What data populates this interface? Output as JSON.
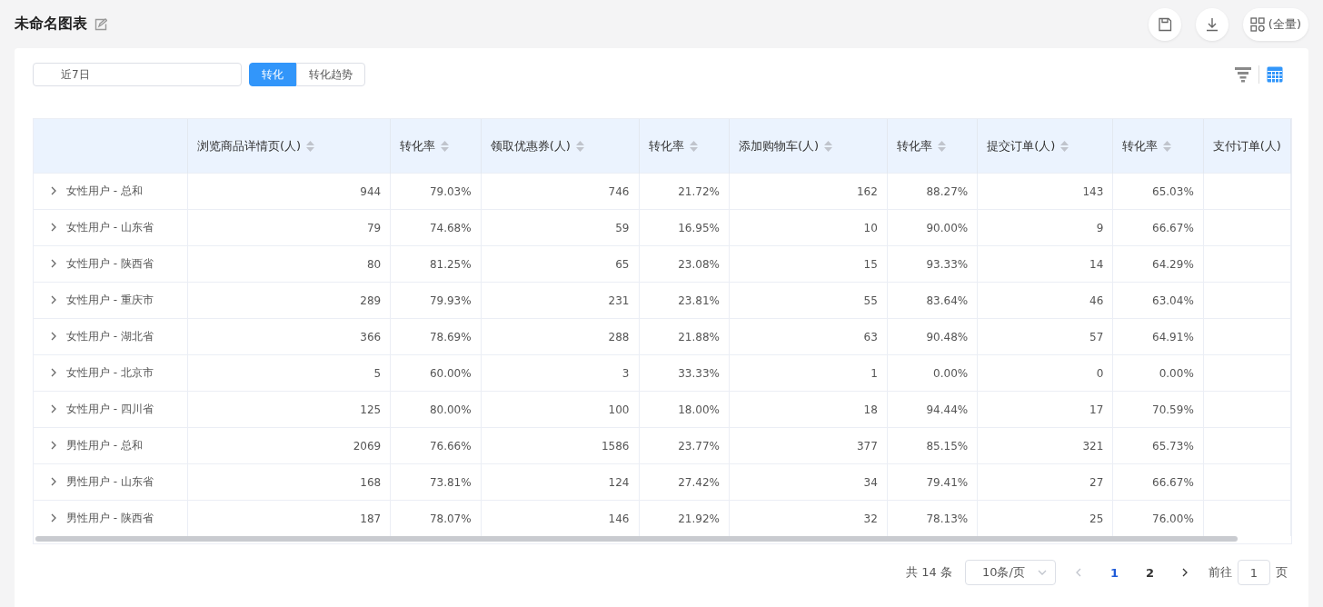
{
  "header": {
    "title": "未命名图表",
    "actions": [
      {
        "kind": "save"
      },
      {
        "kind": "download"
      },
      {
        "kind": "layout",
        "label": "(全量)"
      }
    ]
  },
  "toolbar": {
    "date_range": {
      "value": "近7日"
    },
    "tabs": [
      {
        "label": "转化",
        "selected": true
      },
      {
        "label": "转化趋势",
        "selected": false
      }
    ],
    "view_toggles": [
      {
        "kind": "funnel",
        "selected": false
      },
      {
        "kind": "table",
        "selected": true
      }
    ]
  },
  "table": {
    "columns": [
      {
        "sortable": false
      },
      {
        "label": "浏览商品详情页(人)",
        "sortable": true
      },
      {
        "label": "转化率",
        "sortable": true
      },
      {
        "label": "领取优惠券(人)",
        "sortable": true
      },
      {
        "label": "转化率",
        "sortable": true
      },
      {
        "label": "添加购物车(人)",
        "sortable": true
      },
      {
        "label": "转化率",
        "sortable": true
      },
      {
        "label": "提交订单(人)",
        "sortable": true
      },
      {
        "label": "转化率",
        "sortable": true
      },
      {
        "label": "支付订单(人)",
        "sortable": false
      }
    ],
    "rows": [
      {
        "expanded": false,
        "cells": [
          "女性用户 - 总和",
          "944",
          "79.03%",
          "746",
          "21.72%",
          "162",
          "88.27%",
          "143",
          "65.03%"
        ]
      },
      {
        "expanded": false,
        "cells": [
          "女性用户 - 山东省",
          "79",
          "74.68%",
          "59",
          "16.95%",
          "10",
          "90.00%",
          "9",
          "66.67%"
        ]
      },
      {
        "expanded": false,
        "cells": [
          "女性用户 - 陕西省",
          "80",
          "81.25%",
          "65",
          "23.08%",
          "15",
          "93.33%",
          "14",
          "64.29%"
        ]
      },
      {
        "expanded": false,
        "cells": [
          "女性用户 - 重庆市",
          "289",
          "79.93%",
          "231",
          "23.81%",
          "55",
          "83.64%",
          "46",
          "63.04%"
        ]
      },
      {
        "expanded": false,
        "cells": [
          "女性用户 - 湖北省",
          "366",
          "78.69%",
          "288",
          "21.88%",
          "63",
          "90.48%",
          "57",
          "64.91%"
        ]
      },
      {
        "expanded": false,
        "cells": [
          "女性用户 - 北京市",
          "5",
          "60.00%",
          "3",
          "33.33%",
          "1",
          "0.00%",
          "0",
          "0.00%"
        ]
      },
      {
        "expanded": false,
        "cells": [
          "女性用户 - 四川省",
          "125",
          "80.00%",
          "100",
          "18.00%",
          "18",
          "94.44%",
          "17",
          "70.59%"
        ]
      },
      {
        "expanded": false,
        "cells": [
          "男性用户 - 总和",
          "2069",
          "76.66%",
          "1586",
          "23.77%",
          "377",
          "85.15%",
          "321",
          "65.73%"
        ]
      },
      {
        "expanded": false,
        "cells": [
          "男性用户 - 山东省",
          "168",
          "73.81%",
          "124",
          "27.42%",
          "34",
          "79.41%",
          "27",
          "66.67%"
        ]
      },
      {
        "expanded": false,
        "cells": [
          "男性用户 - 陕西省",
          "187",
          "78.07%",
          "146",
          "21.92%",
          "32",
          "78.13%",
          "25",
          "76.00%"
        ]
      }
    ]
  },
  "pagination": {
    "total": "共 14 条",
    "page_size": "10条/页",
    "prev": {
      "disabled": true
    },
    "pages": [
      {
        "label": "1",
        "selected": true
      },
      {
        "label": "2",
        "selected": false
      }
    ],
    "next": {
      "disabled": false
    },
    "goto_label": "前往",
    "goto_value": "1",
    "goto_suffix": "页"
  }
}
